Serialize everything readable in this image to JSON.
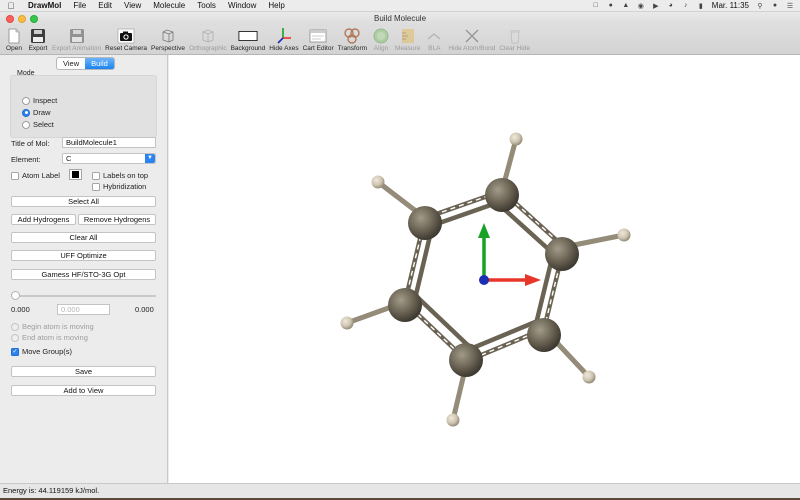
{
  "menubar": {
    "app_name": "DrawMol",
    "menus": [
      "File",
      "Edit",
      "View",
      "Molecule",
      "Tools",
      "Window",
      "Help"
    ],
    "clock": "Mar. 11:35"
  },
  "window": {
    "title": "Build Molecule"
  },
  "toolbar": {
    "items": [
      {
        "label": "Open",
        "icon": "open-icon",
        "enabled": true
      },
      {
        "label": "Export",
        "icon": "save-icon",
        "enabled": true
      },
      {
        "label": "Export Animation",
        "icon": "save-icon",
        "enabled": false
      },
      {
        "label": "Reset Camera",
        "icon": "camera-icon",
        "enabled": true
      },
      {
        "label": "Perspective",
        "icon": "perspective-cube-icon",
        "enabled": true
      },
      {
        "label": "Orthographic",
        "icon": "orthographic-cube-icon",
        "enabled": false
      },
      {
        "label": "Background",
        "icon": "background-rect-icon",
        "enabled": true
      },
      {
        "label": "Hide Axes",
        "icon": "axes-icon",
        "enabled": true
      },
      {
        "label": "Cart Editor",
        "icon": "cart-editor-icon",
        "enabled": true
      },
      {
        "label": "Transform",
        "icon": "transform-icon",
        "enabled": true
      },
      {
        "label": "Align",
        "icon": "align-icon",
        "enabled": false
      },
      {
        "label": "Measure",
        "icon": "measure-icon",
        "enabled": false
      },
      {
        "label": "BLA",
        "icon": "bla-icon",
        "enabled": false
      },
      {
        "label": "Hide Atom/Bond",
        "icon": "hide-atom-bond-icon",
        "enabled": false
      },
      {
        "label": "Clear Hide",
        "icon": "clear-hide-icon",
        "enabled": false
      }
    ]
  },
  "panel": {
    "tabs": [
      "View",
      "Build"
    ],
    "active_tab": "Build",
    "mode_title": "Mode",
    "modes": [
      "Inspect",
      "Draw",
      "Select"
    ],
    "selected_mode": "Draw",
    "title_label": "Title of Mol:",
    "title_value": "BuildMolecule1",
    "element_label": "Element:",
    "element_value": "C",
    "atom_label": "Atom Label",
    "labels_on_top": "Labels on top",
    "hybridization": "Hybridization",
    "select_all": "Select All",
    "add_hydrogens": "Add Hydrogens",
    "remove_hydrogens": "Remove Hydrogens",
    "clear_all": "Clear All",
    "uff_optimize": "UFF Optimize",
    "gamess_opt": "Gamess HF/STO-3G Opt",
    "slider_min": "0.000",
    "slider_value": "0.000",
    "slider_max": "0.000",
    "begin_atom": "Begin atom is moving",
    "end_atom": "End atom is moving",
    "move_groups": "Move Group(s)",
    "move_groups_checked": true,
    "save": "Save",
    "add_to_view": "Add to View"
  },
  "status": {
    "text": "Energy is: 44.119159 kJ/mol."
  },
  "colors": {
    "accent": "#2a83ef",
    "carbon": "#6e6656",
    "hydrogen": "#d8cfbd",
    "bond": "#ffffff",
    "axis_x": "#e8352a",
    "axis_y": "#19a126",
    "axis_z": "#1b2fb5"
  }
}
